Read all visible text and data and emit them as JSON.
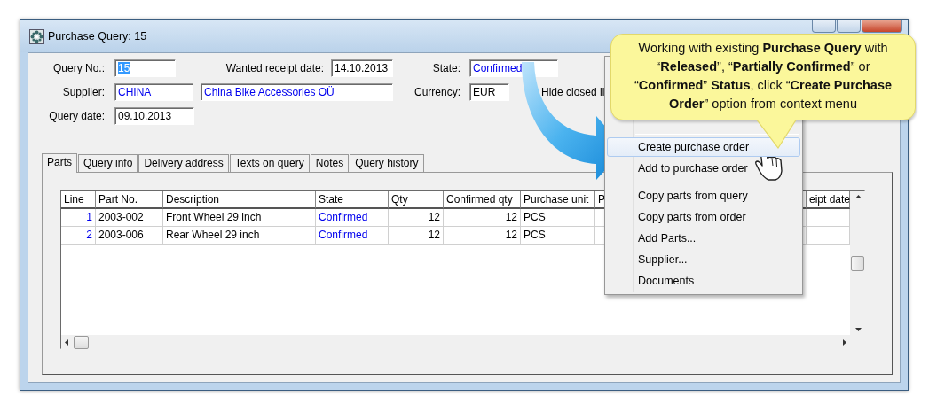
{
  "window": {
    "title": "Purchase Query: 15"
  },
  "form_rows": [
    [
      {
        "kind": "label",
        "text": "Query No.:"
      },
      {
        "kind": "input",
        "value": "15",
        "link": false,
        "selected": true
      },
      {
        "kind": "label",
        "text": "Wanted receipt date:"
      },
      {
        "kind": "input",
        "value": "14.10.2013",
        "link": false,
        "selected": false
      },
      {
        "kind": "label",
        "text": "State:"
      },
      {
        "kind": "input",
        "value": "Confirmed",
        "link": true,
        "selected": false
      }
    ],
    [
      {
        "kind": "label",
        "text": "Supplier:"
      },
      {
        "kind": "input",
        "value": "CHINA",
        "link": true,
        "selected": false
      },
      {
        "kind": "input",
        "value": "China Bike Accessories OÜ",
        "link": true,
        "selected": false
      },
      {
        "kind": "label",
        "text": "Currency:"
      },
      {
        "kind": "input",
        "value": "EUR",
        "link": false,
        "selected": false
      },
      {
        "kind": "checkbox",
        "text": "Hide closed li"
      }
    ],
    [
      {
        "kind": "label",
        "text": "Query date:"
      },
      {
        "kind": "input",
        "value": "09.10.2013",
        "link": false,
        "selected": false
      }
    ]
  ],
  "tabs": [
    {
      "label": "Parts",
      "selected": true
    },
    {
      "label": "Query info",
      "selected": false
    },
    {
      "label": "Delivery address",
      "selected": false
    },
    {
      "label": "Texts on query",
      "selected": false
    },
    {
      "label": "Notes",
      "selected": false
    },
    {
      "label": "Query history",
      "selected": false
    }
  ],
  "table": {
    "columns": [
      "Line",
      "Part No.",
      "Description",
      "State",
      "Qty",
      "Confirmed qty",
      "Purchase unit",
      "P",
      "eipt date"
    ],
    "rows": [
      {
        "line": "1",
        "part_no": "2003-002",
        "description": "Front Wheel 29 inch",
        "state": "Confirmed",
        "qty": "12",
        "confirmed_qty": "12",
        "purchase_unit": "PCS"
      },
      {
        "line": "2",
        "part_no": "2003-006",
        "description": "Rear Wheel 29 inch",
        "state": "Confirmed",
        "qty": "12",
        "confirmed_qty": "12",
        "purchase_unit": "PCS"
      }
    ]
  },
  "context_menu": [
    {
      "kind": "separator"
    },
    {
      "kind": "item",
      "label": "Create purchase order",
      "selected": true
    },
    {
      "kind": "item",
      "label": "Add to purchase order",
      "selected": false
    },
    {
      "kind": "separator"
    },
    {
      "kind": "item",
      "label": "Copy parts from query",
      "selected": false
    },
    {
      "kind": "item",
      "label": "Copy parts from order",
      "selected": false
    },
    {
      "kind": "item",
      "label": "Add Parts...",
      "selected": false
    },
    {
      "kind": "item",
      "label": "Supplier...",
      "selected": false
    },
    {
      "kind": "item",
      "label": "Documents",
      "selected": false
    }
  ],
  "callout": {
    "text": "Working with existing **Purchase Query** with “**Released**”, “**Partially Confirmed**” or “**Confirmed**”  **Status**, click “**Create Purchase Order**” option from context menu"
  }
}
